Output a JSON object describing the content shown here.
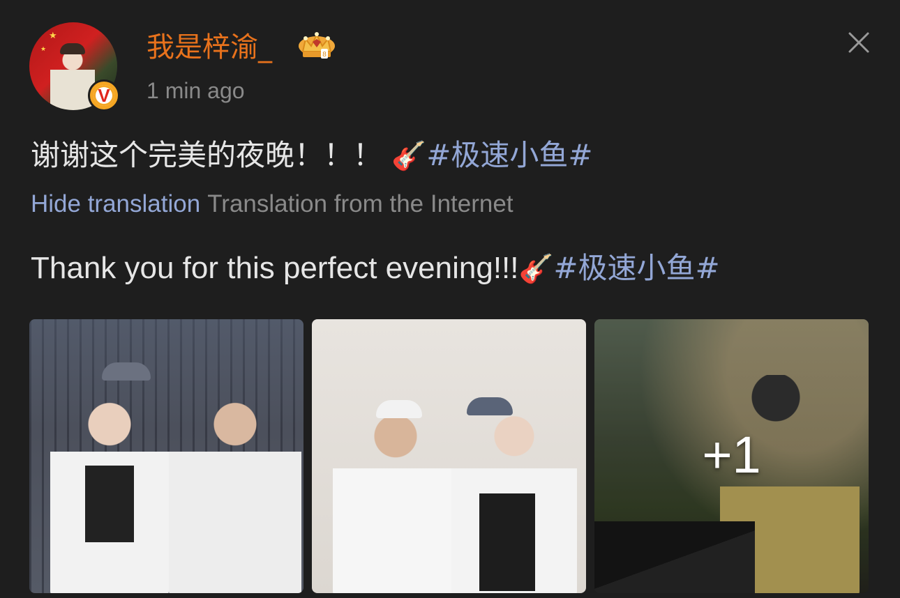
{
  "header": {
    "username": "我是梓渝_",
    "timestamp": "1 min ago",
    "badge_text": "V"
  },
  "post": {
    "original_text": "谢谢这个完美的夜晚！！！",
    "emoji": "🎸",
    "hashtag": "#极速小鱼#",
    "hide_translation_label": "Hide translation",
    "translation_source": "Translation from the Internet",
    "translated_text": "Thank you for this perfect evening!!!"
  },
  "photos": {
    "more_count": "+1"
  },
  "icons": {
    "crown": "crown-badge-icon",
    "close": "close-icon",
    "verified": "verified-v-icon"
  },
  "colors": {
    "background": "#1e1e1e",
    "username": "#e8721c",
    "link": "#93a7d6",
    "muted": "#8a8a8a",
    "text": "#e6e6e6",
    "badge": "#f5a623"
  }
}
